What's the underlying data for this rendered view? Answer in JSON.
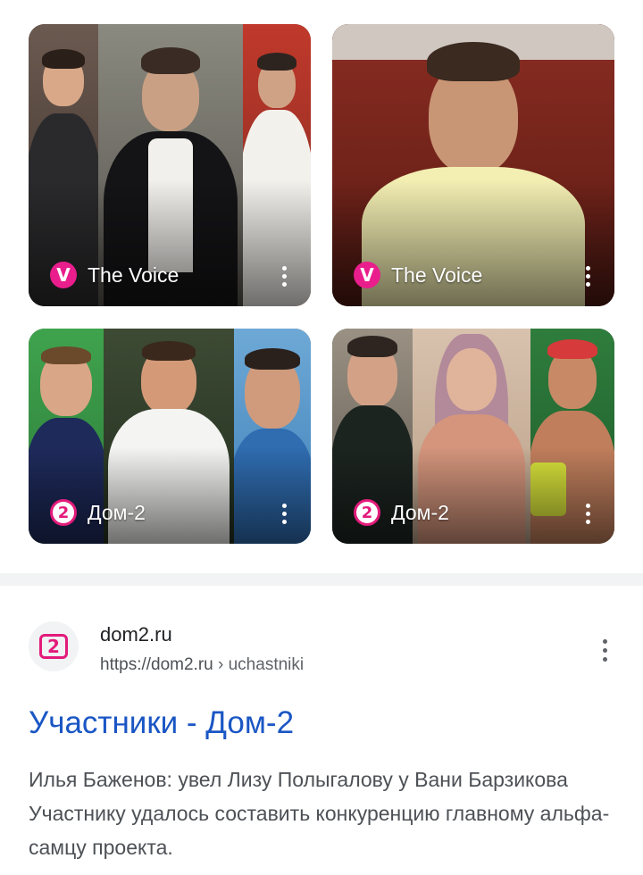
{
  "video_cards": [
    {
      "channel_badge": "V",
      "title": "The Voice",
      "more_icon": "more-vert-icon"
    },
    {
      "channel_badge": "V",
      "title": "The Voice",
      "more_icon": "more-vert-icon"
    },
    {
      "channel_badge": "2",
      "title": "Дом-2",
      "more_icon": "more-vert-icon"
    },
    {
      "channel_badge": "2",
      "title": "Дом-2",
      "more_icon": "more-vert-icon"
    }
  ],
  "result": {
    "favicon_text": "2",
    "site_name": "dom2.ru",
    "url_base": "https://dom2.ru",
    "url_path": " › uchastniki",
    "title": "Участники - Дом-2",
    "snippet": "Илья Баженов: увел Лизу Полыгалову у Вани Барзикова Участнику удалось составить конкуренцию главному альфа-самцу проекта."
  },
  "colors": {
    "link": "#1a56c4",
    "brand_pink": "#e31b7b",
    "voice_badge": "#e91e8c",
    "snippet_text": "#4d5156"
  }
}
